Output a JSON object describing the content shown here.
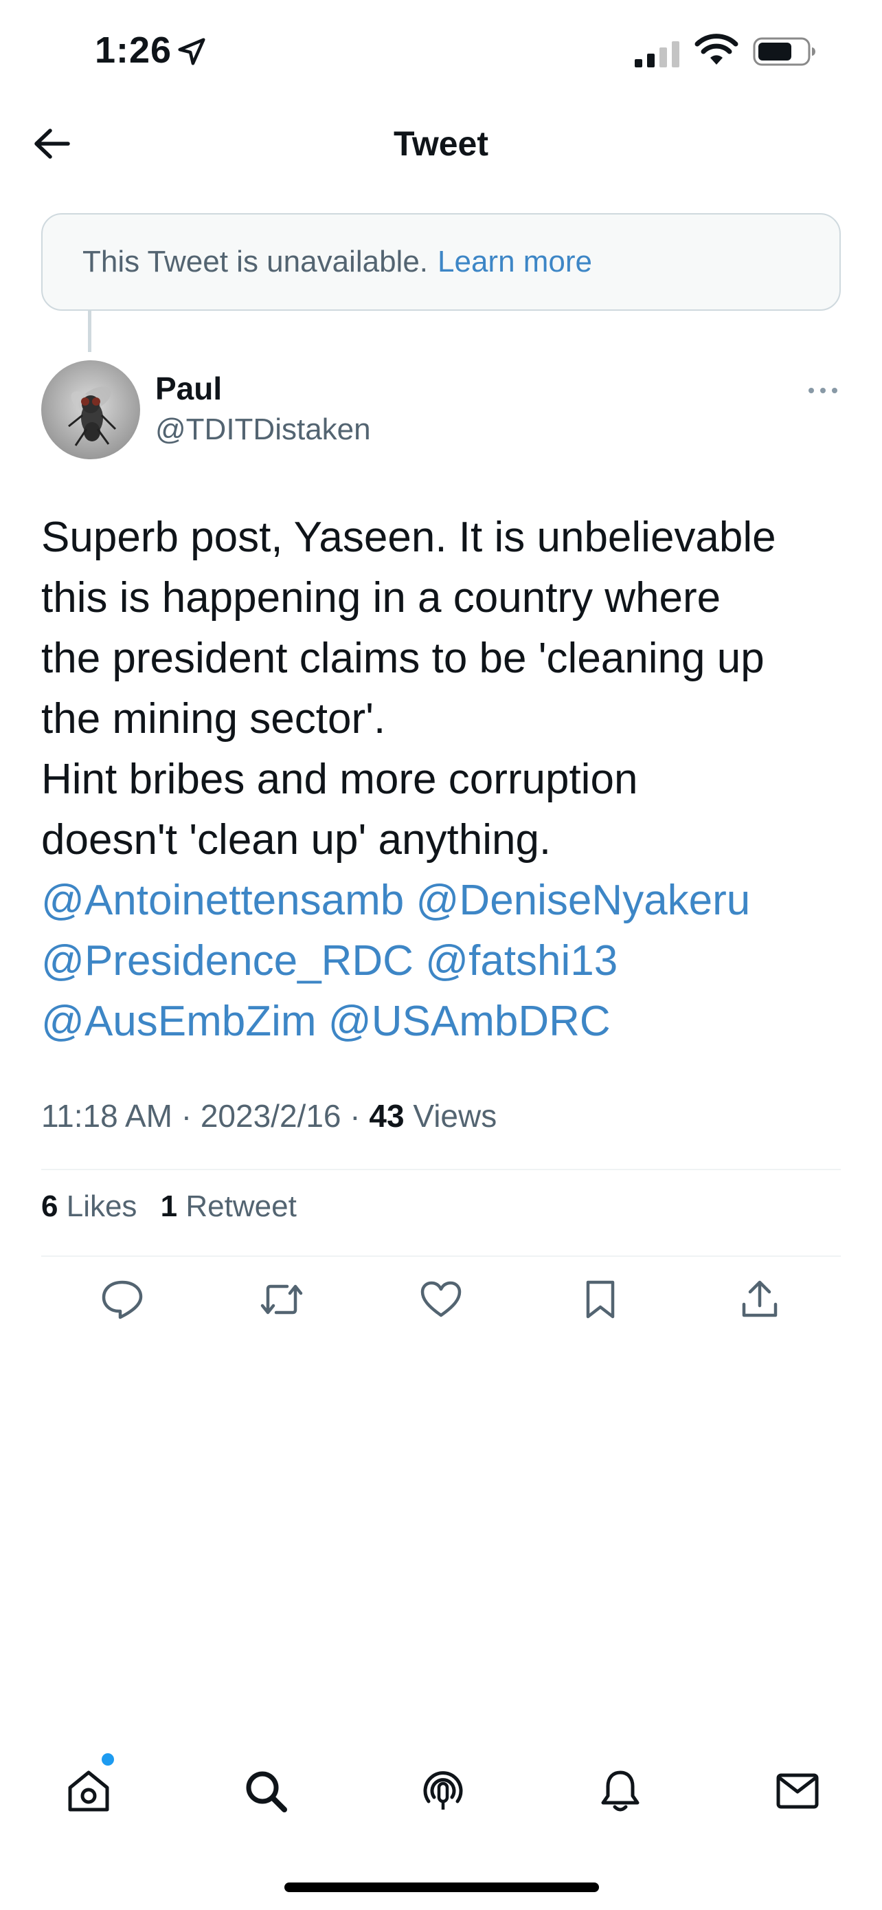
{
  "status_bar": {
    "time": "1:26"
  },
  "header": {
    "title": "Tweet"
  },
  "unavailable": {
    "message": "This Tweet is unavailable.",
    "link": "Learn more"
  },
  "author": {
    "name": "Paul",
    "handle": "@TDITDistaken"
  },
  "tweet": {
    "lines": [
      "Superb post, Yaseen.  It is unbelievable",
      "this is happening in a country where",
      "the president claims to be 'cleaning up",
      "the mining sector'.",
      "Hint bribes and more corruption",
      "doesn't  'clean up' anything."
    ],
    "mentions": [
      "@Antoinettensamb",
      "@DeniseNyakeru",
      "@Presidence_RDC",
      "@fatshi13",
      "@AusEmbZim",
      "@USAmbDRC"
    ]
  },
  "meta": {
    "time": "11:18 AM",
    "date": "2023/2/16",
    "views_count": "43",
    "views_label": "Views",
    "separator": "·"
  },
  "stats": {
    "likes_count": "6",
    "likes_label": "Likes",
    "retweets_count": "1",
    "retweets_label": "Retweet"
  },
  "icons": {
    "actions": [
      "reply-icon",
      "retweet-icon",
      "like-icon",
      "bookmark-icon",
      "share-icon"
    ],
    "tabs": [
      "home-icon",
      "search-icon",
      "spaces-icon",
      "notifications-icon",
      "messages-icon"
    ]
  },
  "colors": {
    "link": "#3d86c6",
    "notification_dot": "#1d9bf0"
  }
}
